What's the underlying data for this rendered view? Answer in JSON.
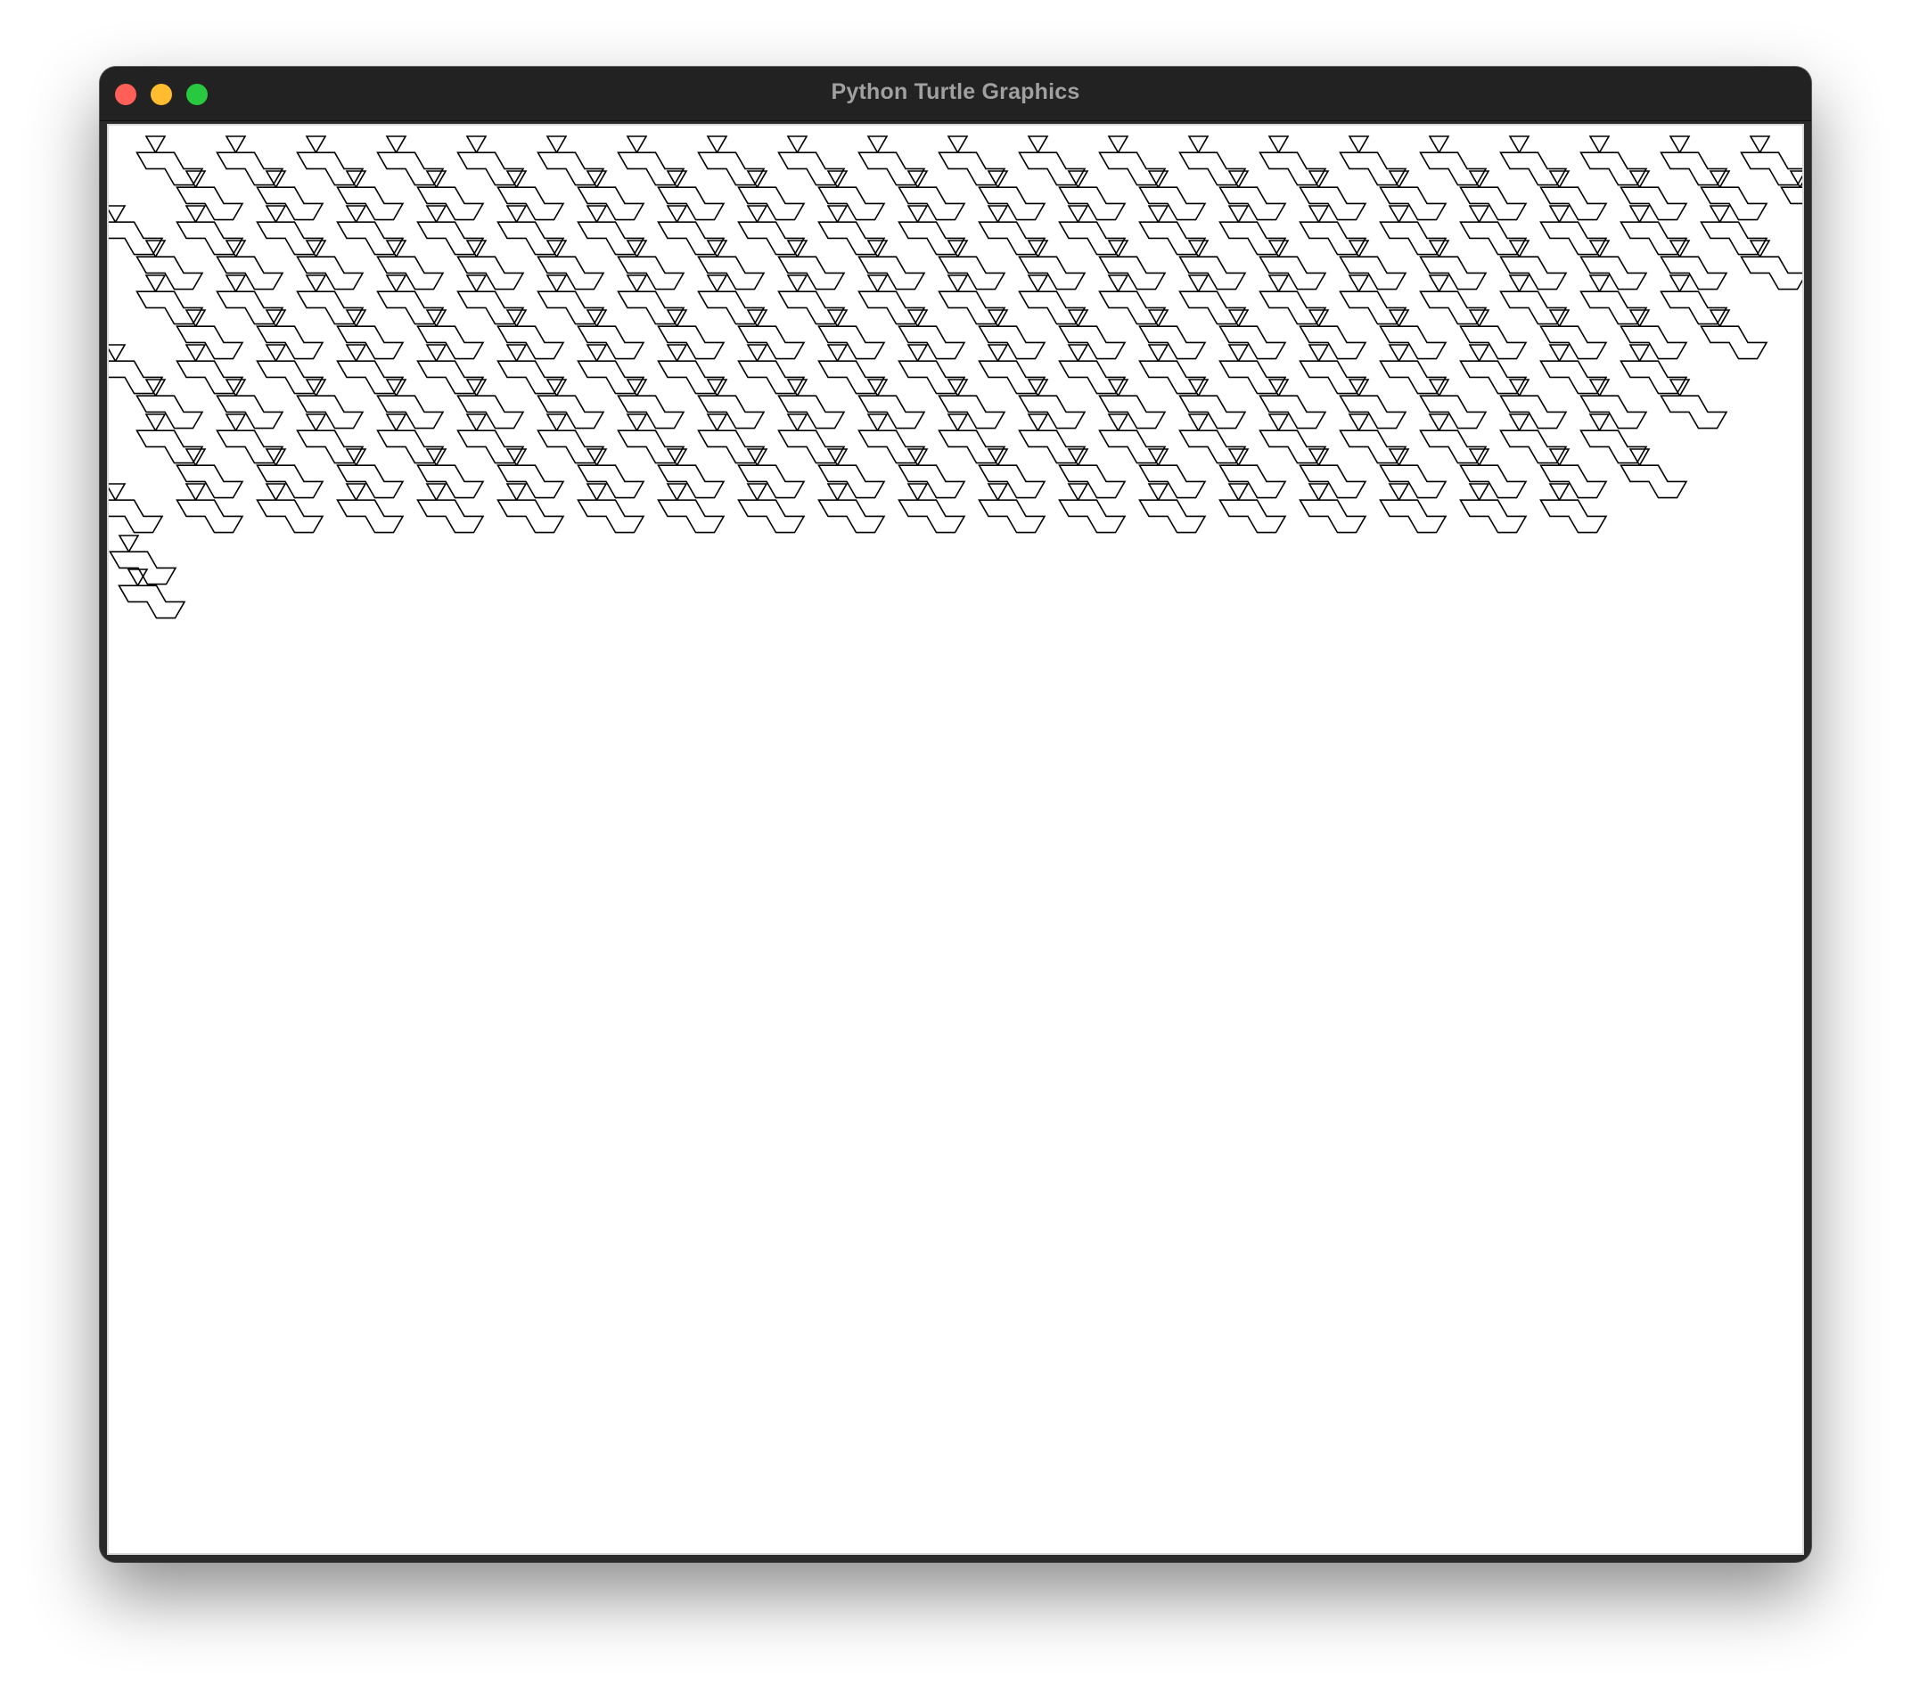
{
  "window": {
    "title": "Python Turtle Graphics"
  },
  "canvas": {
    "background": "#ffffff",
    "pen_color": "#000000",
    "pattern": {
      "name": "interlocking Y-tile tessellation",
      "rows": 6,
      "tiles_per_row": 21
    }
  },
  "colors": {
    "titlebar": "#222222",
    "title_text": "#a0a0a0",
    "close": "#ff5f57",
    "minimize": "#febc2e",
    "zoom": "#28c840"
  }
}
